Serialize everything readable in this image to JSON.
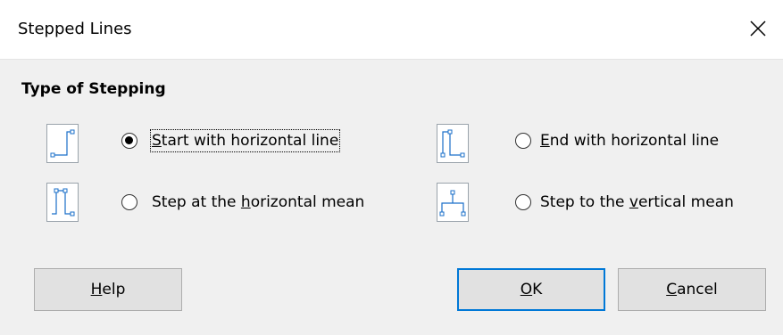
{
  "dialog": {
    "title": "Stepped Lines"
  },
  "section": {
    "title": "Type of Stepping"
  },
  "options": [
    {
      "label_pre": "",
      "label_ul": "S",
      "label_post": "tart with horizontal line",
      "selected": true
    },
    {
      "label_pre": "",
      "label_ul": "E",
      "label_post": "nd with horizontal line",
      "selected": false
    },
    {
      "label_pre": "Step at the ",
      "label_ul": "h",
      "label_post": "orizontal mean",
      "selected": false
    },
    {
      "label_pre": "Step to the ",
      "label_ul": "v",
      "label_post": "ertical mean",
      "selected": false
    }
  ],
  "buttons": {
    "help": {
      "label_ul": "H",
      "label_post": "elp"
    },
    "ok": {
      "label_ul": "O",
      "label_post": "K"
    },
    "cancel": {
      "label_ul": "C",
      "label_post": "ancel"
    }
  },
  "icons": {
    "close": "close-icon",
    "option_icons": [
      "step-start-horizontal-icon",
      "step-end-horizontal-icon",
      "step-horizontal-mean-icon",
      "step-vertical-mean-icon"
    ]
  },
  "colors": {
    "accent": "#0078d7",
    "handle": "#1a6fc9"
  }
}
